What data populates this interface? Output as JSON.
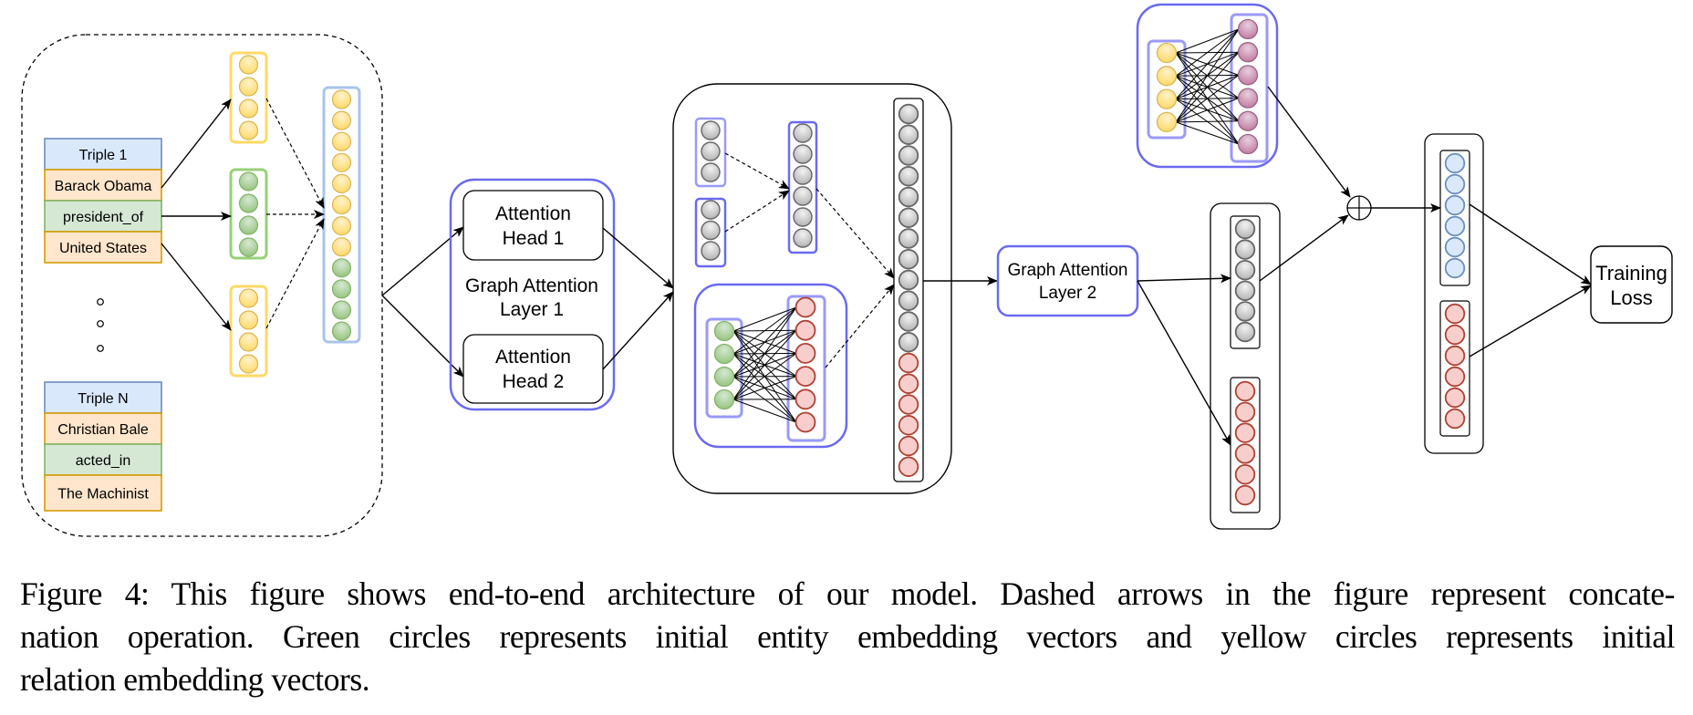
{
  "figure": {
    "caption_lines": [
      "Figure 4: This figure shows end-to-end architecture of our model. Dashed arrows in the figure represent concate-",
      "nation operation.  Green circles represents initial entity embedding vectors and yellow circles represents initial",
      "relation embedding vectors."
    ]
  },
  "input_panel": {
    "triples": [
      {
        "header": "Triple 1",
        "head": "Barack Obama",
        "relation": "president_of",
        "tail": "United States"
      },
      {
        "header": "Triple N",
        "head": "Christian Bale",
        "relation": "acted_in",
        "tail": "The Machinist"
      }
    ],
    "ellipsis_count": 3,
    "vectors": [
      {
        "role": "head",
        "color": "yellow",
        "size": 4
      },
      {
        "role": "relation",
        "color": "green",
        "size": 4
      },
      {
        "role": "tail",
        "color": "yellow",
        "size": 4
      }
    ],
    "concat_vector": [
      "yellow",
      "yellow",
      "yellow",
      "yellow",
      "yellow",
      "yellow",
      "yellow",
      "yellow",
      "green",
      "green",
      "green",
      "green"
    ]
  },
  "gat_layer1": {
    "title": "Graph Attention Layer 1",
    "title_lines": [
      "Graph Attention",
      "Layer 1"
    ],
    "heads": [
      {
        "label_lines": [
          "Attention",
          "Head 1"
        ]
      },
      {
        "label_lines": [
          "Attention",
          "Head 2"
        ]
      }
    ]
  },
  "middle_block": {
    "head_vectors": [
      3,
      3
    ],
    "head_concat_size": 6,
    "entity_projection": {
      "inputs": 4,
      "outputs": 6
    },
    "output_vector": {
      "gray": 12,
      "red": 6
    }
  },
  "gat_layer2": {
    "title_lines": [
      "Graph Attention",
      "Layer 2"
    ]
  },
  "relation_projection": {
    "inputs": 4,
    "outputs": 6
  },
  "layer2_outputs": {
    "gray": 6,
    "red": 6
  },
  "sum_operator": {
    "symbol": "⊕"
  },
  "final_embeddings": {
    "blue": 6,
    "red": 6
  },
  "training_loss": {
    "label_lines": [
      "Training",
      "Loss"
    ]
  },
  "colors": {
    "yellow_fill": "#ffe599",
    "yellow_stroke": "#d6b656",
    "yellow_box": "#ffd966",
    "green_fill": "#b9d9a6",
    "green_stroke": "#82b366",
    "green_box": "#97d077",
    "gray_fill": "#d0d0d0",
    "gray_stroke": "#666666",
    "red_fill": "#f8cecc",
    "red_stroke": "#ae4132",
    "purple_fill": "#d5a0c2",
    "purple_stroke": "#996185",
    "blue_fill": "#dae8fc",
    "blue_stroke": "#6c8ebf",
    "concat_box": "#a9c4eb",
    "attention_box": "#6a6af0",
    "attention_box_light": "#9a9af7",
    "header_fill": "#dae8fc",
    "header_stroke": "#6c8ebf",
    "entity_fill": "#ffe6cc",
    "entity_stroke": "#d79b00",
    "relation_fill": "#d5e8d4",
    "relation_stroke": "#82b366"
  }
}
